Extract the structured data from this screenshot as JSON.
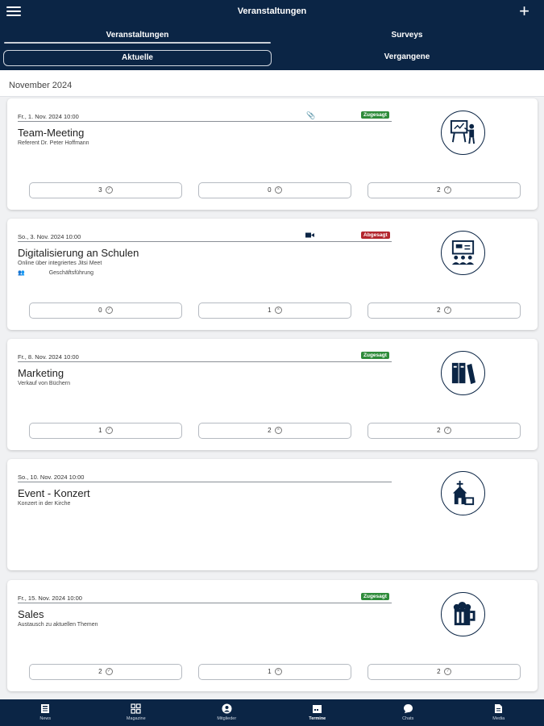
{
  "header": {
    "title": "Veranstaltungen",
    "tabs": [
      "Veranstaltungen",
      "Surveys"
    ],
    "segments": [
      "Aktuelle",
      "Vergangene"
    ]
  },
  "month": "November 2024",
  "events": [
    {
      "date": "Fr., 1. Nov. 2024 10:00",
      "title": "Team-Meeting",
      "subtitle": "Referent Dr. Peter Hoffmann",
      "badge": "Zugesagt",
      "badge_color": "#2e8b3a",
      "icon": "presentation-icon",
      "counts": [
        "3",
        "0",
        "2"
      ]
    },
    {
      "date": "So., 3. Nov. 2024 10:00",
      "title": "Digitalisierung an Schulen",
      "subtitle": "Online über integriertes Jitsi Meet",
      "department": "Geschäftsführung",
      "badge": "Abgesagt",
      "badge_color": "#b3262e",
      "icon": "classroom-icon",
      "counts": [
        "0",
        "1",
        "2"
      ]
    },
    {
      "date": "Fr., 8. Nov. 2024 10:00",
      "title": "Marketing",
      "subtitle": "Verkauf von Büchern",
      "badge": "Zugesagt",
      "badge_color": "#2e8b3a",
      "icon": "books-icon",
      "counts": [
        "1",
        "2",
        "2"
      ]
    },
    {
      "date": "So., 10. Nov. 2024 10:00",
      "title": "Event - Konzert",
      "subtitle": "Konzert in der Kirche",
      "icon": "church-icon"
    },
    {
      "date": "Fr., 15. Nov. 2024 10:00",
      "title": "Sales",
      "subtitle": "Austausch zu aktuellen Themen",
      "badge": "Zugesagt",
      "badge_color": "#2e8b3a",
      "icon": "beer-mug-icon",
      "counts": [
        "2",
        "1",
        "2"
      ]
    }
  ],
  "bottom_nav": [
    {
      "label": "News",
      "icon": "newspaper-icon"
    },
    {
      "label": "Magazine",
      "icon": "grid-icon"
    },
    {
      "label": "Mitglieder",
      "icon": "person-icon"
    },
    {
      "label": "Termine",
      "icon": "calendar-icon",
      "active": true
    },
    {
      "label": "Chats",
      "icon": "chat-icon"
    },
    {
      "label": "Media",
      "icon": "document-icon"
    }
  ],
  "colors": {
    "navy": "#0b2545",
    "accepted": "#2e8b3a",
    "declined": "#b3262e"
  }
}
